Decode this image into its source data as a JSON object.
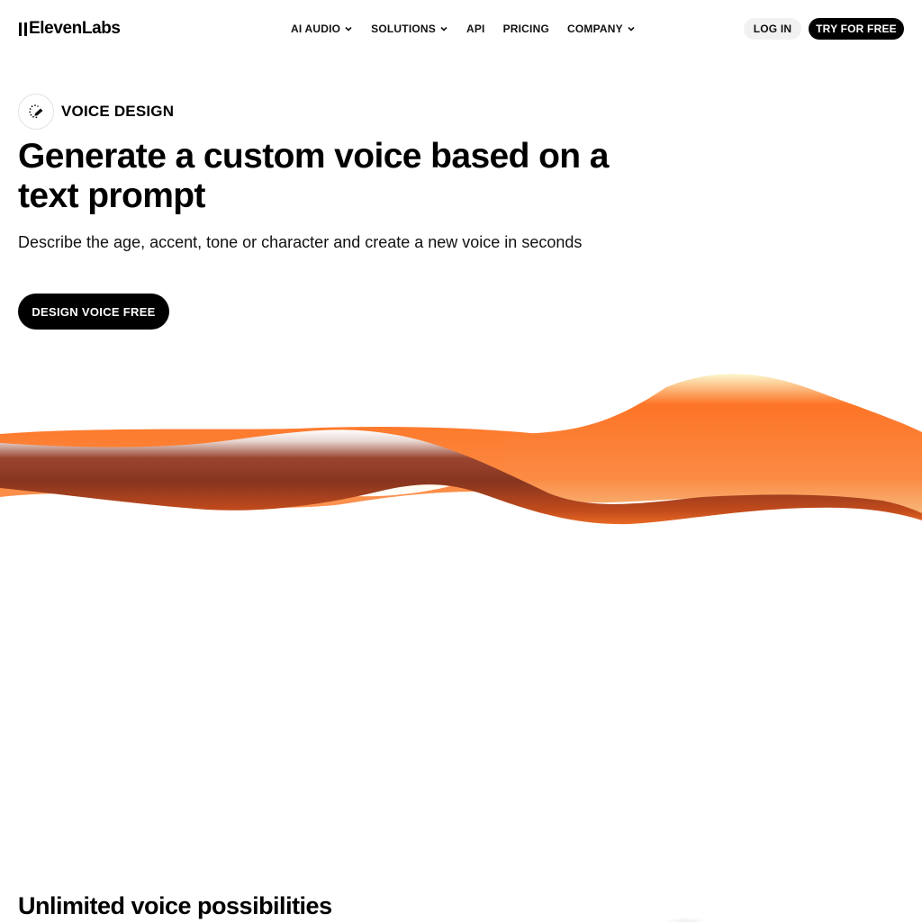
{
  "header": {
    "logo_text": "ElevenLabs",
    "nav": [
      {
        "label": "AI AUDIO",
        "has_dropdown": true
      },
      {
        "label": "SOLUTIONS",
        "has_dropdown": true
      },
      {
        "label": "API",
        "has_dropdown": false
      },
      {
        "label": "PRICING",
        "has_dropdown": false
      },
      {
        "label": "COMPANY",
        "has_dropdown": true
      }
    ],
    "login_label": "LOG IN",
    "try_label": "TRY FOR FREE"
  },
  "hero": {
    "badge_icon": "voice-design-icon",
    "badge_label": "VOICE DESIGN",
    "title": "Generate a custom voice based on a text prompt",
    "subtitle": "Describe the age, accent, tone or character and create a new voice in seconds",
    "cta_label": "DESIGN VOICE FREE"
  },
  "wave": {
    "colors": {
      "orange": "#fd7426",
      "dark_brown": "#87351f",
      "light_peach": "#f7b67a",
      "cream": "#fbf7cc",
      "white": "#ffffff"
    }
  },
  "section": {
    "title": "Unlimited voice possibilities"
  }
}
